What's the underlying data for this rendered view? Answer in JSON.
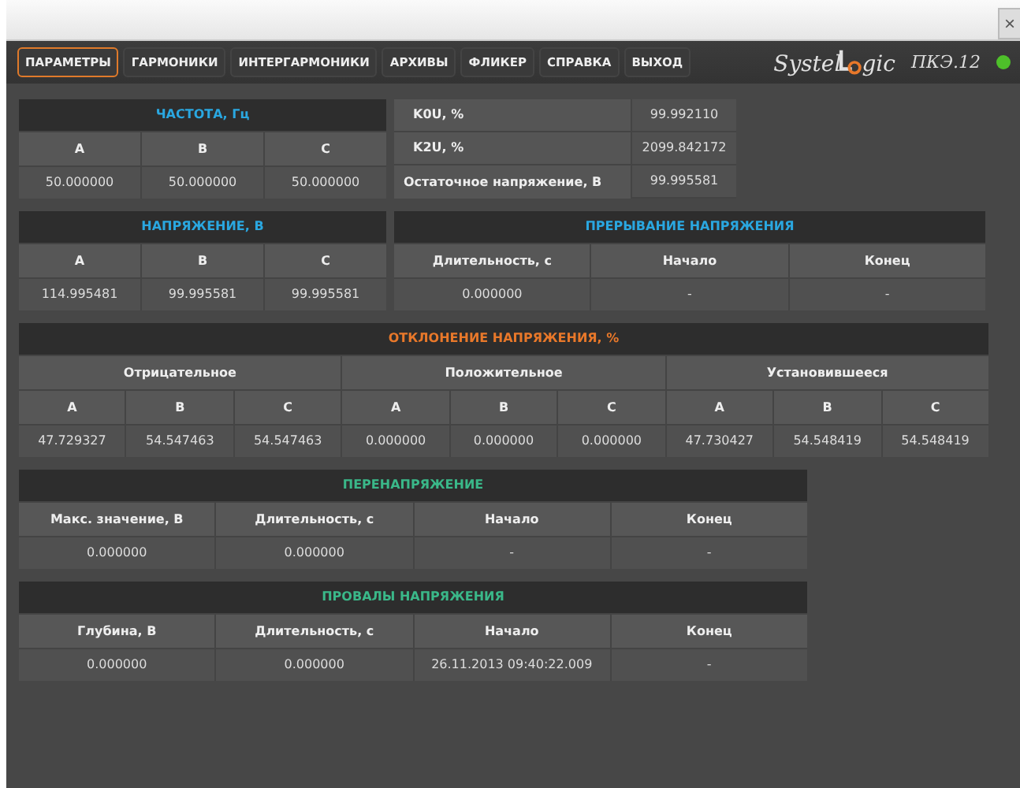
{
  "window": {
    "close_label": "×"
  },
  "menu": [
    {
      "label": "ПАРАМЕТРЫ",
      "selected": true
    },
    {
      "label": "ГАРМОНИКИ",
      "selected": false
    },
    {
      "label": "ИНТЕРГАРМОНИКИ",
      "selected": false
    },
    {
      "label": "АРХИВЫ",
      "selected": false
    },
    {
      "label": "ФЛИКЕР",
      "selected": false
    },
    {
      "label": "СПРАВКА",
      "selected": false
    },
    {
      "label": "ВЫХОД",
      "selected": false
    }
  ],
  "brand": {
    "logo_start": "Systel",
    "logo_end": "gic",
    "device": "ПКЭ.12",
    "online": true
  },
  "frequency": {
    "title": "ЧАСТОТА, Гц",
    "color": "#2aa7e0",
    "columns": [
      "A",
      "B",
      "C"
    ],
    "rows": [
      [
        "50.000000",
        "50.000000",
        "50.000000"
      ]
    ]
  },
  "coefficients": [
    {
      "label": "K0U, %",
      "value": "99.992110"
    },
    {
      "label": "K2U, %",
      "value": "2099.842172"
    },
    {
      "label": "Остаточное напряжение, В",
      "value": "99.995581"
    }
  ],
  "voltage": {
    "title": "НАПРЯЖЕНИЕ, В",
    "color": "#2aa7e0",
    "columns": [
      "A",
      "B",
      "C"
    ],
    "rows": [
      [
        "114.995481",
        "99.995581",
        "99.995581"
      ]
    ]
  },
  "interruption": {
    "title": "ПРЕРЫВАНИЕ НАПРЯЖЕНИЯ",
    "color": "#2aa7e0",
    "columns": [
      "Длительность, с",
      "Начало",
      "Конец"
    ],
    "rows": [
      [
        "0.000000",
        "-",
        "-"
      ]
    ]
  },
  "deviation": {
    "title": "ОТКЛОНЕНИЕ НАПРЯЖЕНИЯ, %",
    "color": "#e8782a",
    "groups": [
      {
        "label": "Отрицательное",
        "columns": [
          "A",
          "B",
          "C"
        ]
      },
      {
        "label": "Положительное",
        "columns": [
          "A",
          "B",
          "C"
        ]
      },
      {
        "label": "Установившееся",
        "columns": [
          "A",
          "B",
          "C"
        ]
      }
    ],
    "rows": [
      [
        "47.729327",
        "54.547463",
        "54.547463",
        "0.000000",
        "0.000000",
        "0.000000",
        "47.730427",
        "54.548419",
        "54.548419"
      ]
    ]
  },
  "overvoltage": {
    "title": "ПЕРЕНАПРЯЖЕНИЕ",
    "color": "#3ab889",
    "columns": [
      "Макс. значение, В",
      "Длительность, с",
      "Начало",
      "Конец"
    ],
    "rows": [
      [
        "0.000000",
        "0.000000",
        "-",
        "-"
      ]
    ]
  },
  "dips": {
    "title": "ПРОВАЛЫ НАПРЯЖЕНИЯ",
    "color": "#3ab889",
    "columns": [
      "Глубина, В",
      "Длительность, с",
      "Начало",
      "Конец"
    ],
    "rows": [
      [
        "0.000000",
        "0.000000",
        "26.11.2013 09:40:22.009",
        "-"
      ]
    ]
  }
}
